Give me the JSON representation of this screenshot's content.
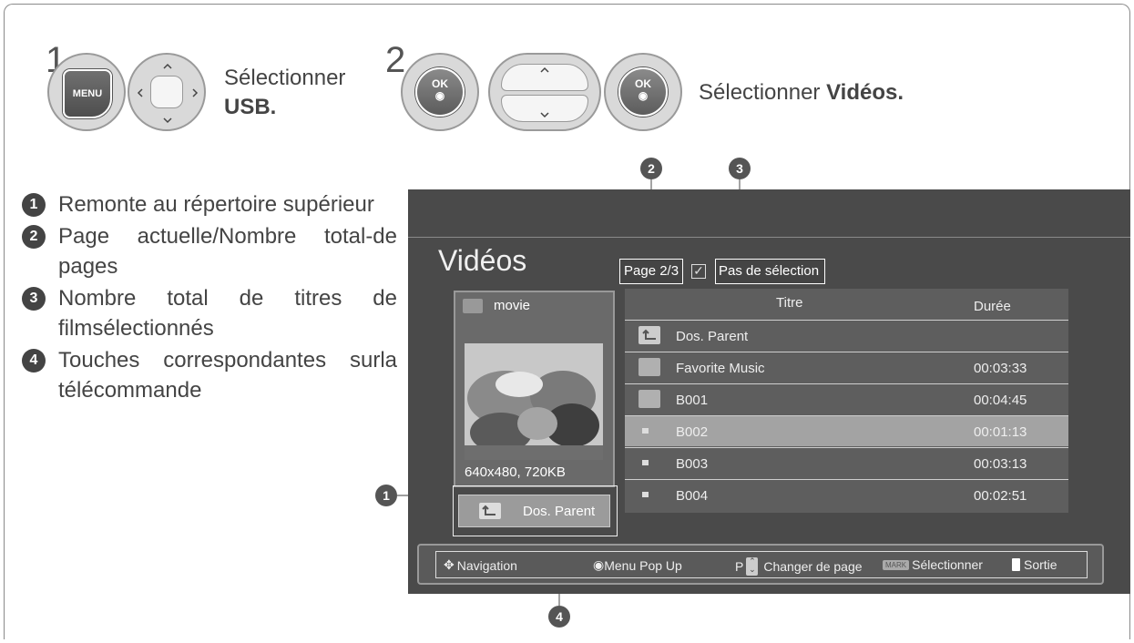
{
  "steps": [
    {
      "number": "1",
      "buttons": [
        "MENU",
        "nav-pad"
      ],
      "text": "Sélectionner",
      "bold": "USB."
    },
    {
      "number": "2",
      "buttons": [
        "OK",
        "up-down",
        "OK"
      ],
      "text": "Sélectionner ",
      "bold": "Vidéos."
    }
  ],
  "keys": {
    "menu": "MENU",
    "ok": "OK"
  },
  "legend": [
    {
      "num": "1",
      "text": "Remonte au répertoire supérieur"
    },
    {
      "num": "2",
      "text": "Page actuelle/Nombre total-de pages"
    },
    {
      "num": "3",
      "text": "Nombre total de titres de filmsélectionnés"
    },
    {
      "num": "4",
      "text": "Touches correspondantes surla télécommande"
    }
  ],
  "callouts": [
    "1",
    "2",
    "3",
    "4"
  ],
  "screen": {
    "title": "Vidéos",
    "page": "Page 2/3",
    "selection": "Pas de sélection",
    "thumb": {
      "folder": "movie",
      "caption": "640x480, 720KB"
    },
    "parent_button": "Dos. Parent",
    "table": {
      "headers": {
        "title": "Titre",
        "duration": "Durée"
      },
      "rows": [
        {
          "title": "Dos. Parent",
          "duration": "",
          "icon": "parent-folder-icon"
        },
        {
          "title": "Favorite Music",
          "duration": "00:03:33",
          "icon": "folder-icon"
        },
        {
          "title": "B001",
          "duration": "00:04:45",
          "icon": "folder-icon"
        },
        {
          "title": "B002",
          "duration": "00:01:13",
          "icon": "file-icon",
          "highlight": true
        },
        {
          "title": "B003",
          "duration": "00:03:13",
          "icon": "file-icon"
        },
        {
          "title": "B004",
          "duration": "00:02:51",
          "icon": "file-icon"
        }
      ]
    },
    "footer": {
      "navigation": "Navigation",
      "popup": "Menu Pop Up",
      "page_key": "P",
      "page_change": "Changer de page",
      "mark_key": "MARK",
      "select": "Sélectionner",
      "exit": "Sortie"
    }
  }
}
